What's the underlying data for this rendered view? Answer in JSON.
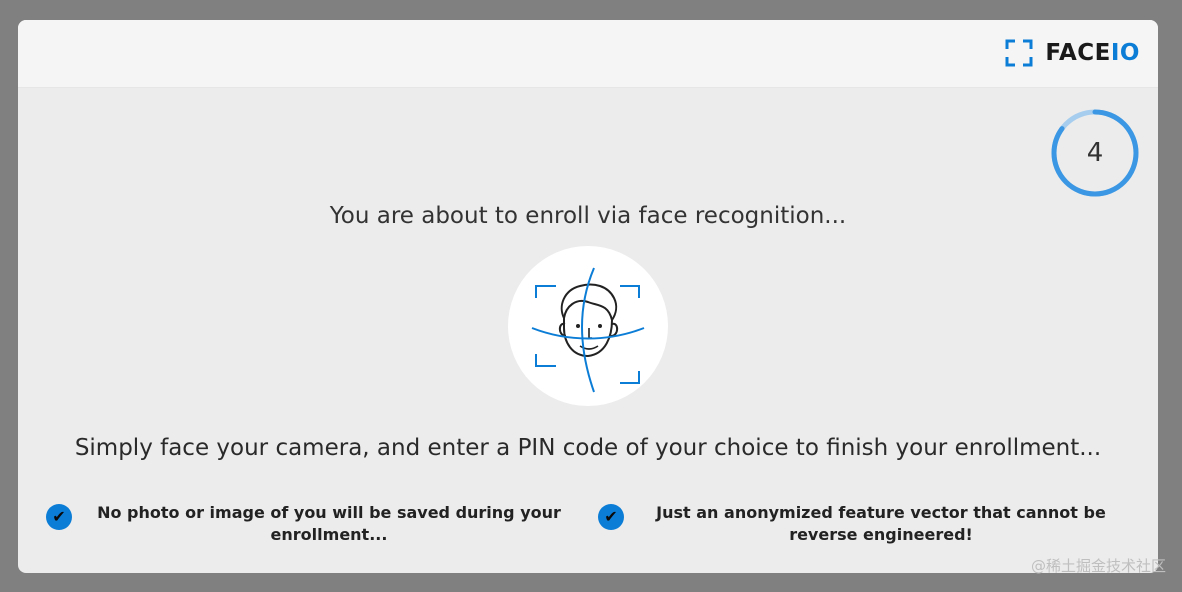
{
  "brand": {
    "name_prefix": "FACE",
    "name_suffix": "IO",
    "accent_color": "#0c7dd6"
  },
  "countdown": {
    "value": "4",
    "progress_fraction": 0.85
  },
  "intro_text": "You are about to enroll via face recognition...",
  "instructions_text": "Simply face your camera, and enter a PIN code of your choice to finish your enrollment...",
  "features": [
    {
      "icon": "check-icon",
      "text": "No photo or image of you will be saved during your enrollment..."
    },
    {
      "icon": "check-icon",
      "text": "Just an anonymized feature vector that cannot be reverse engineered!"
    }
  ],
  "watermark": "@稀土掘金技术社区"
}
